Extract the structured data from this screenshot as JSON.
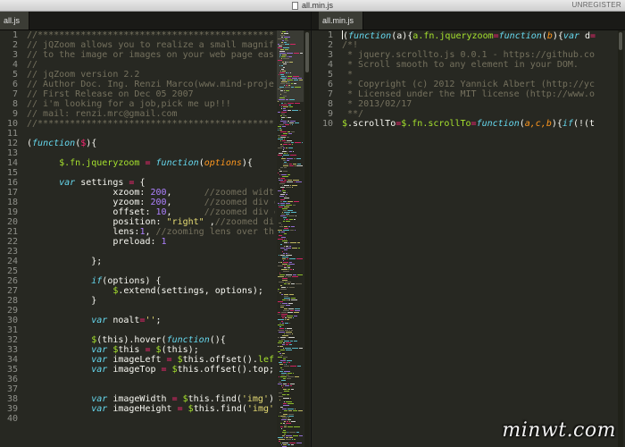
{
  "window": {
    "title": "all.min.js",
    "unregistered": "UNREGISTER"
  },
  "left": {
    "tab": "all.js",
    "line_numbers": [
      "1",
      "2",
      "3",
      "4",
      "5",
      "6",
      "7",
      "8",
      "9",
      "10",
      "11",
      "12",
      "13",
      "14",
      "15",
      "16",
      "17",
      "18",
      "19",
      "20",
      "21",
      "22",
      "23",
      "24",
      "25",
      "26",
      "27",
      "28",
      "29",
      "30",
      "31",
      "32",
      "33",
      "34",
      "35",
      "36",
      "37",
      "38",
      "39",
      "40"
    ],
    "lines": [
      [
        [
          "cm",
          "//**********************************************"
        ]
      ],
      [
        [
          "cm",
          "// jQZoom allows you to realize a small magnif"
        ]
      ],
      [
        [
          "cm",
          "// to the image or images on your web page eas"
        ]
      ],
      [
        [
          "cm",
          "//"
        ]
      ],
      [
        [
          "cm",
          "// jqZoom version 2.2"
        ]
      ],
      [
        [
          "cm",
          "// Author Doc. Ing. Renzi Marco(www.mind-proje"
        ]
      ],
      [
        [
          "cm",
          "// First Release on Dec 05 2007"
        ]
      ],
      [
        [
          "cm",
          "// i'm looking for a job,pick me up!!!"
        ]
      ],
      [
        [
          "cm",
          "// mail: renzi.mrc@gmail.com"
        ]
      ],
      [
        [
          "cm",
          "//**********************************************"
        ]
      ],
      [],
      [
        [
          "txt",
          "("
        ],
        [
          "kw",
          "function"
        ],
        [
          "txt",
          "("
        ],
        [
          "op",
          "$"
        ],
        [
          "txt",
          "){"
        ]
      ],
      [],
      [
        [
          "txt",
          "      "
        ],
        [
          "fn",
          "$.fn.jqueryzoom"
        ],
        [
          "txt",
          " "
        ],
        [
          "op",
          "="
        ],
        [
          "txt",
          " "
        ],
        [
          "kw",
          "function"
        ],
        [
          "txt",
          "("
        ],
        [
          "par",
          "options"
        ],
        [
          "txt",
          "){"
        ]
      ],
      [],
      [
        [
          "txt",
          "      "
        ],
        [
          "kw",
          "var"
        ],
        [
          "txt",
          " settings "
        ],
        [
          "op",
          "="
        ],
        [
          "txt",
          " {"
        ]
      ],
      [
        [
          "txt",
          "                xzoom: "
        ],
        [
          "num",
          "200"
        ],
        [
          "txt",
          ",      "
        ],
        [
          "cm",
          "//zoomed width"
        ]
      ],
      [
        [
          "txt",
          "                yzoom: "
        ],
        [
          "num",
          "200"
        ],
        [
          "txt",
          ",      "
        ],
        [
          "cm",
          "//zoomed div d"
        ]
      ],
      [
        [
          "txt",
          "                offset: "
        ],
        [
          "num",
          "10"
        ],
        [
          "txt",
          ",      "
        ],
        [
          "cm",
          "//zoomed div d"
        ]
      ],
      [
        [
          "txt",
          "                position: "
        ],
        [
          "str",
          "\"right\""
        ],
        [
          "txt",
          " ,"
        ],
        [
          "cm",
          "//zoomed di"
        ]
      ],
      [
        [
          "txt",
          "                lens:"
        ],
        [
          "num",
          "1"
        ],
        [
          "txt",
          ", "
        ],
        [
          "cm",
          "//zooming lens over th"
        ]
      ],
      [
        [
          "txt",
          "                preload: "
        ],
        [
          "num",
          "1"
        ]
      ],
      [],
      [
        [
          "txt",
          "            };"
        ]
      ],
      [],
      [
        [
          "txt",
          "            "
        ],
        [
          "kw",
          "if"
        ],
        [
          "txt",
          "(options) {"
        ]
      ],
      [
        [
          "txt",
          "                "
        ],
        [
          "fn",
          "$"
        ],
        [
          "txt",
          ".extend(settings, options);"
        ]
      ],
      [
        [
          "txt",
          "            }"
        ]
      ],
      [],
      [
        [
          "txt",
          "            "
        ],
        [
          "kw",
          "var"
        ],
        [
          "txt",
          " noalt"
        ],
        [
          "op",
          "="
        ],
        [
          "str",
          "''"
        ],
        [
          "txt",
          ";"
        ]
      ],
      [],
      [
        [
          "txt",
          "            "
        ],
        [
          "fn",
          "$"
        ],
        [
          "txt",
          "(this).hover("
        ],
        [
          "kw",
          "function"
        ],
        [
          "txt",
          "(){"
        ]
      ],
      [
        [
          "txt",
          "            "
        ],
        [
          "kw",
          "var"
        ],
        [
          "txt",
          " "
        ],
        [
          "fn",
          "$"
        ],
        [
          "txt",
          "this "
        ],
        [
          "op",
          "="
        ],
        [
          "txt",
          " "
        ],
        [
          "fn",
          "$"
        ],
        [
          "txt",
          "(this);"
        ]
      ],
      [
        [
          "txt",
          "            "
        ],
        [
          "kw",
          "var"
        ],
        [
          "txt",
          " imageLeft "
        ],
        [
          "op",
          "="
        ],
        [
          "txt",
          " "
        ],
        [
          "fn",
          "$"
        ],
        [
          "txt",
          "this.offset()."
        ],
        [
          "fn",
          "lef"
        ]
      ],
      [
        [
          "txt",
          "            "
        ],
        [
          "kw",
          "var"
        ],
        [
          "txt",
          " imageTop "
        ],
        [
          "op",
          "="
        ],
        [
          "txt",
          " "
        ],
        [
          "fn",
          "$"
        ],
        [
          "txt",
          "this.offset().top;"
        ]
      ],
      [],
      [],
      [
        [
          "txt",
          "            "
        ],
        [
          "kw",
          "var"
        ],
        [
          "txt",
          " imageWidth "
        ],
        [
          "op",
          "="
        ],
        [
          "txt",
          " "
        ],
        [
          "fn",
          "$"
        ],
        [
          "txt",
          "this.find("
        ],
        [
          "str",
          "'img'"
        ],
        [
          "txt",
          ")."
        ]
      ],
      [
        [
          "txt",
          "            "
        ],
        [
          "kw",
          "var"
        ],
        [
          "txt",
          " imageHeight "
        ],
        [
          "op",
          "="
        ],
        [
          "txt",
          " "
        ],
        [
          "fn",
          "$"
        ],
        [
          "txt",
          "this.find("
        ],
        [
          "str",
          "'img'"
        ]
      ],
      []
    ]
  },
  "right": {
    "tab": "all.min.js",
    "line_numbers": [
      "1",
      "2",
      "3",
      "4",
      "5",
      "6",
      "7",
      "8",
      "9",
      "10"
    ],
    "lines": [
      [
        [
          "cursor",
          ""
        ],
        [
          "txt",
          "("
        ],
        [
          "kw",
          "function"
        ],
        [
          "txt",
          "(a){"
        ],
        [
          "fn",
          "a.fn.jqueryzoom"
        ],
        [
          "op",
          "="
        ],
        [
          "kw",
          "function"
        ],
        [
          "txt",
          "("
        ],
        [
          "par",
          "b"
        ],
        [
          "txt",
          "){"
        ],
        [
          "kw",
          "var"
        ],
        [
          "txt",
          " d"
        ],
        [
          "op",
          "="
        ]
      ],
      [
        [
          "cm",
          "/*!"
        ]
      ],
      [
        [
          "cm",
          " * jquery.scrollto.js 0.0.1 - https://github.co"
        ]
      ],
      [
        [
          "cm",
          " * Scroll smooth to any element in your DOM."
        ]
      ],
      [
        [
          "cm",
          " *"
        ]
      ],
      [
        [
          "cm",
          " * Copyright (c) 2012 Yannick Albert (http://yc"
        ]
      ],
      [
        [
          "cm",
          " * Licensed under the MIT license (http://www.o"
        ]
      ],
      [
        [
          "cm",
          " * 2013/02/17"
        ]
      ],
      [
        [
          "cm",
          " **/"
        ]
      ],
      [
        [
          "fn",
          "$"
        ],
        [
          "txt",
          ".scrollTo"
        ],
        [
          "op",
          "="
        ],
        [
          "fn",
          "$.fn.scrollTo"
        ],
        [
          "op",
          "="
        ],
        [
          "kw",
          "function"
        ],
        [
          "txt",
          "("
        ],
        [
          "par",
          "a,c,b"
        ],
        [
          "txt",
          "){"
        ],
        [
          "kw",
          "if"
        ],
        [
          "txt",
          "(!(t"
        ]
      ]
    ]
  },
  "watermark": "minwt.com"
}
